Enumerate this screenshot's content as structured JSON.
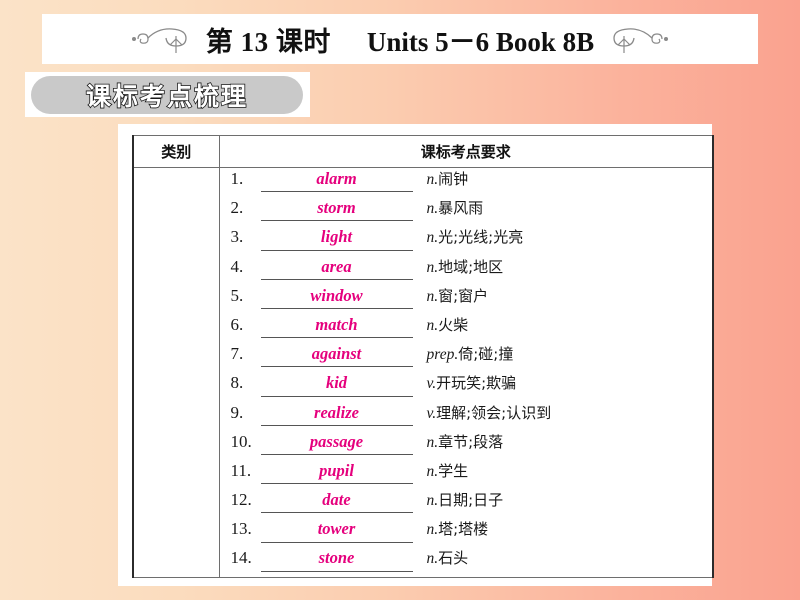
{
  "header": {
    "lesson_title": "第 13 课时",
    "units_title": "Units 5－6 Book 8B",
    "left_flourish_icon": "swirl-flourish-left-icon",
    "right_flourish_icon": "swirl-flourish-right-icon"
  },
  "section": {
    "badge_label": "课标考点梳理"
  },
  "table": {
    "columns": [
      "类别",
      "课标考点要求"
    ],
    "category_value": "",
    "rows": [
      {
        "num": "1.",
        "word": "alarm",
        "pos": "n.",
        "cn": "闹钟"
      },
      {
        "num": "2.",
        "word": "storm",
        "pos": "n.",
        "cn": "暴风雨"
      },
      {
        "num": "3.",
        "word": "light",
        "pos": "n.",
        "cn": "光;光线;光亮"
      },
      {
        "num": "4.",
        "word": "area",
        "pos": "n.",
        "cn": "地域;地区"
      },
      {
        "num": "5.",
        "word": "window",
        "pos": "n.",
        "cn": "窗;窗户"
      },
      {
        "num": "6.",
        "word": "match",
        "pos": "n.",
        "cn": "火柴"
      },
      {
        "num": "7.",
        "word": "against",
        "pos": "prep.",
        "cn": "倚;碰;撞"
      },
      {
        "num": "8.",
        "word": "kid",
        "pos": "v.",
        "cn": "开玩笑;欺骗"
      },
      {
        "num": "9.",
        "word": "realize",
        "pos": "v.",
        "cn": "理解;领会;认识到"
      },
      {
        "num": "10.",
        "word": "passage",
        "pos": "n.",
        "cn": "章节;段落"
      },
      {
        "num": "11.",
        "word": "pupil",
        "pos": "n.",
        "cn": "学生"
      },
      {
        "num": "12.",
        "word": "date",
        "pos": "n.",
        "cn": "日期;日子"
      },
      {
        "num": "13.",
        "word": "tower",
        "pos": "n.",
        "cn": "塔;塔楼"
      },
      {
        "num": "14.",
        "word": "stone",
        "pos": "n.",
        "cn": "石头"
      }
    ]
  },
  "colors": {
    "answer_pink": "#e5007d",
    "bg_left": "#fbe3c8",
    "bg_right": "#faa28f",
    "badge_gray": "#c9c9c9"
  }
}
